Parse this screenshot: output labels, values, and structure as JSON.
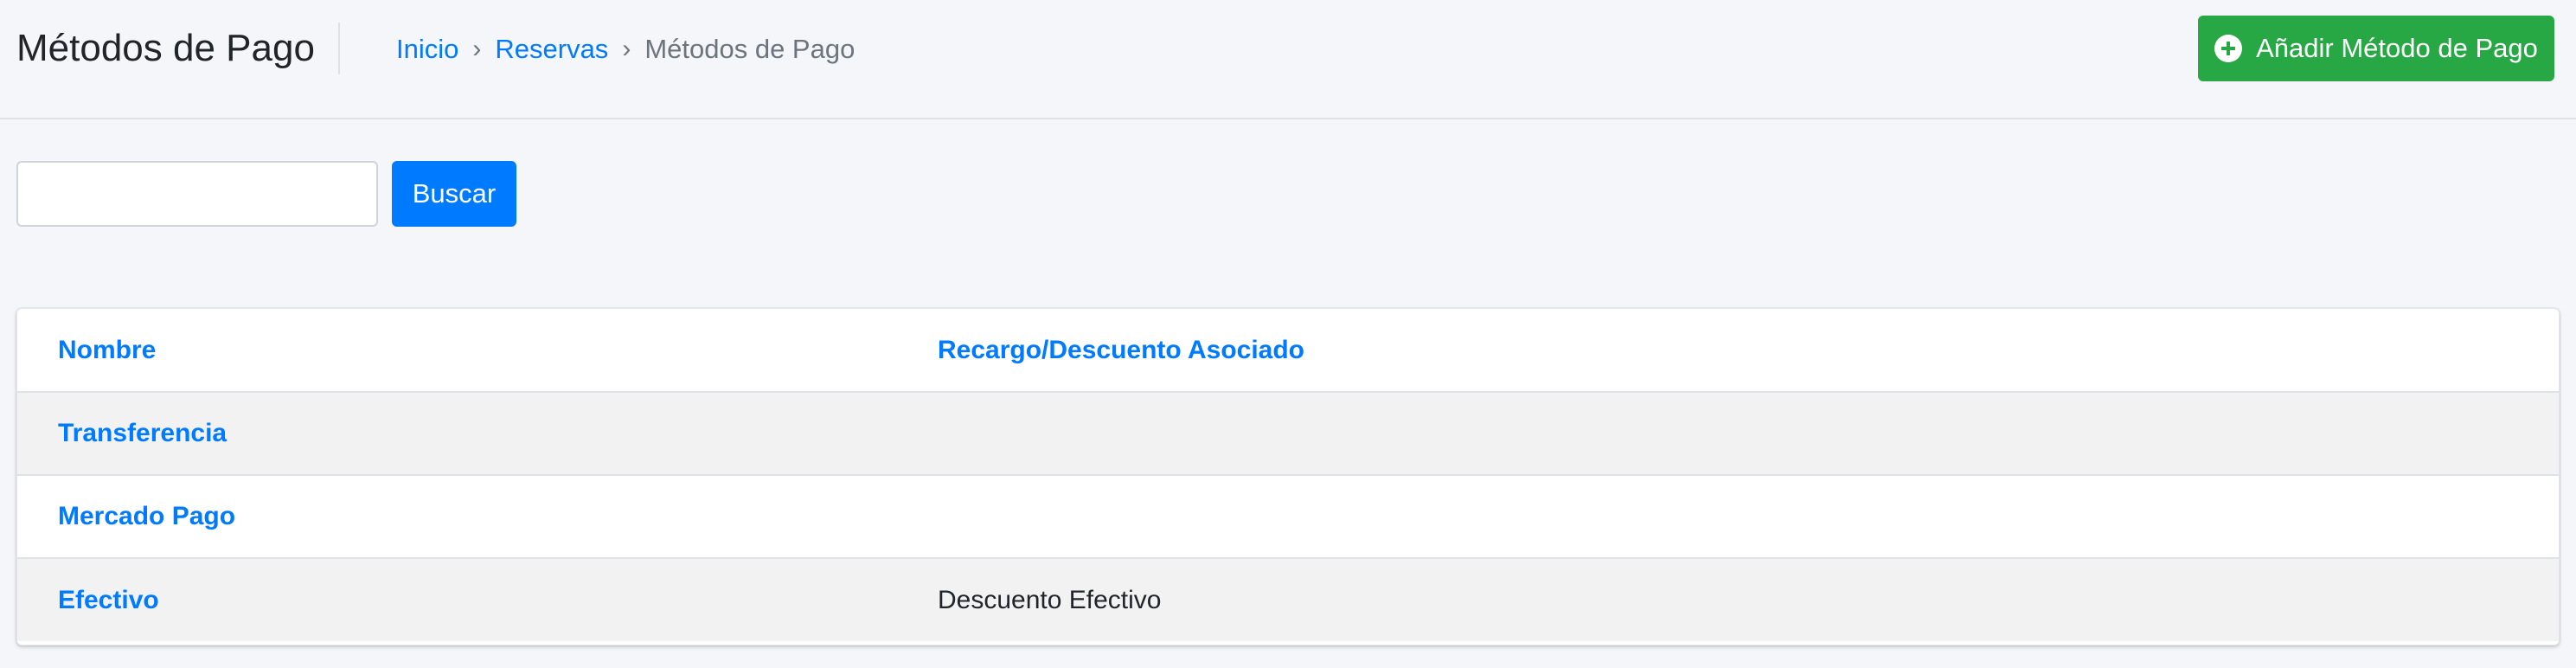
{
  "header": {
    "title": "Métodos de Pago",
    "breadcrumb": [
      {
        "label": "Inicio",
        "link": true
      },
      {
        "label": "Reservas",
        "link": true
      },
      {
        "label": "Métodos de Pago",
        "link": false
      }
    ],
    "breadcrumb_separator": "›",
    "add_button_label": "Añadir Método de Pago",
    "add_button_icon": "plus-circle-icon"
  },
  "search": {
    "value": "",
    "placeholder": "",
    "button_label": "Buscar"
  },
  "table": {
    "columns": [
      "Nombre",
      "Recargo/Descuento Asociado"
    ],
    "rows": [
      {
        "name": "Transferencia",
        "discount": ""
      },
      {
        "name": "Mercado Pago",
        "discount": ""
      },
      {
        "name": "Efectivo",
        "discount": "Descuento Efectivo"
      }
    ]
  },
  "colors": {
    "primary": "#007bff",
    "success": "#28a745",
    "background": "#f4f6f9",
    "row_stripe": "#f2f2f2"
  }
}
